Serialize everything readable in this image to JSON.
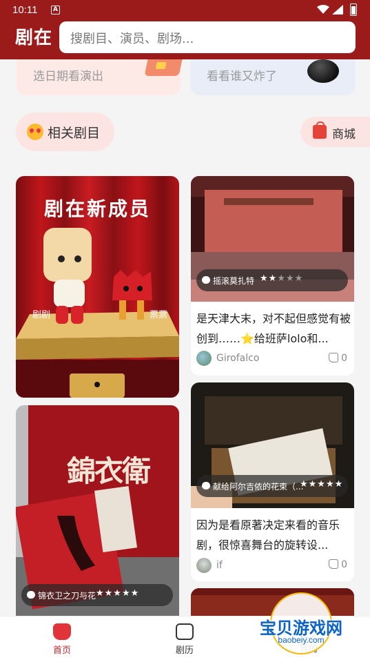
{
  "status_bar": {
    "time": "10:11",
    "notification_icon": "A"
  },
  "header": {
    "logo": "剧在",
    "search_placeholder": "搜剧目、演员、剧场..."
  },
  "quick_entries": [
    {
      "label": "选日期看演出",
      "icon": "calendar-ticket-icon"
    },
    {
      "label": "看看谁又炸了",
      "icon": "bomb-icon"
    }
  ],
  "tabs": {
    "related": "相关剧目",
    "shop": "商城"
  },
  "feed": {
    "left": [
      {
        "image_text": {
          "title": "剧在新成员",
          "left_mascot": "剧剧",
          "right_mascot": "票票"
        },
        "carousel_dots": 1
      },
      {
        "show": "锦衣卫之刀与花",
        "stars": "★★★★★",
        "rating": 5,
        "poster_text": "錦衣衛"
      }
    ],
    "right": [
      {
        "show": "摇滚莫扎特",
        "stars": "★★★★★",
        "rating": 2.5,
        "text": "是天津大末，对不起但感觉有被创到……⭐给班萨lolo和...",
        "author": "Girofalco",
        "likes": "0"
      },
      {
        "show": "献给阿尔吉侬的花束（...",
        "stars": "★★★★★",
        "rating": 5,
        "text": "因为是看原著决定来看的音乐剧，很惊喜舞台的旋转设...",
        "author": "if",
        "likes": "0"
      }
    ]
  },
  "bottom_nav": [
    {
      "label": "首页",
      "active": true
    },
    {
      "label": "剧历",
      "active": false
    },
    {
      "label": "我的",
      "active": false
    }
  ],
  "watermark": {
    "cn": "宝贝游戏网",
    "en": "baobeiy.com"
  },
  "colors": {
    "brand": "#9b1b1b",
    "accent": "#e0333a",
    "chip_bg": "#fbe4e2",
    "star": "#ffffff"
  }
}
